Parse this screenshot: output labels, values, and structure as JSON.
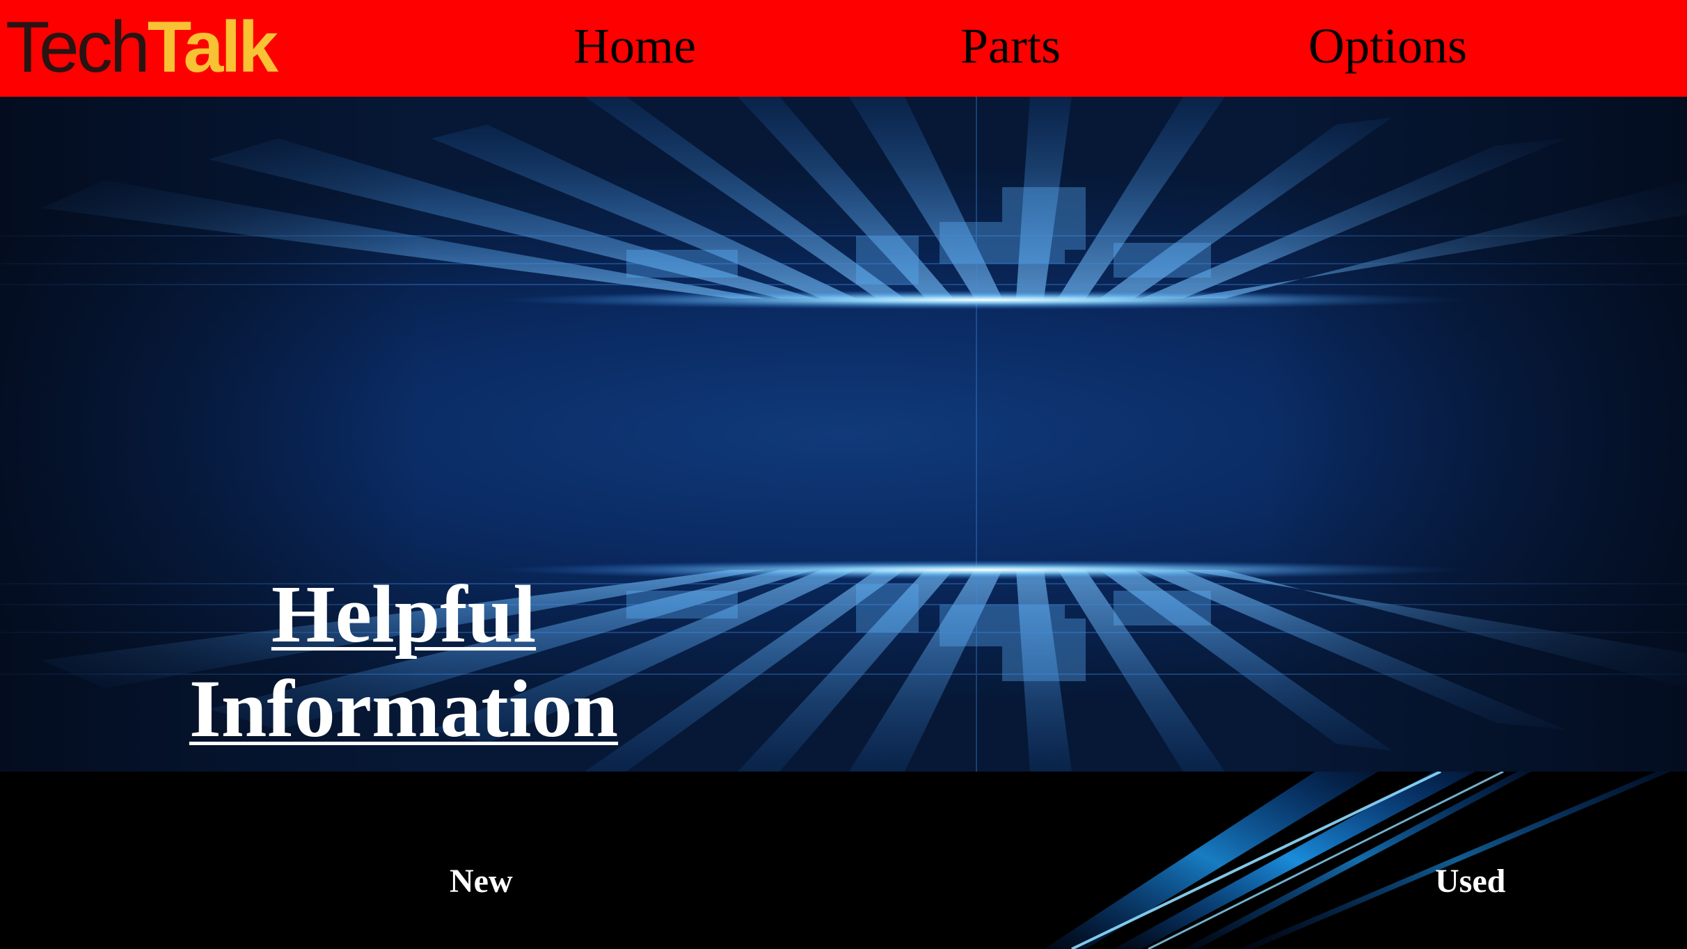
{
  "header": {
    "logo": {
      "part1": "Tech",
      "part2": "Talk"
    },
    "nav": [
      {
        "label": "Home"
      },
      {
        "label": "Parts"
      },
      {
        "label": "Options"
      }
    ]
  },
  "hero": {
    "title": "Helpful Information"
  },
  "footer_links": [
    {
      "label": "New"
    },
    {
      "label": "Used"
    }
  ],
  "colors": {
    "header_bg": "#ff0000",
    "logo_dark": "#2a1413",
    "logo_accent": "#f7c233",
    "hero_blue": "#0a2a62",
    "glow": "#7fd0ff"
  }
}
